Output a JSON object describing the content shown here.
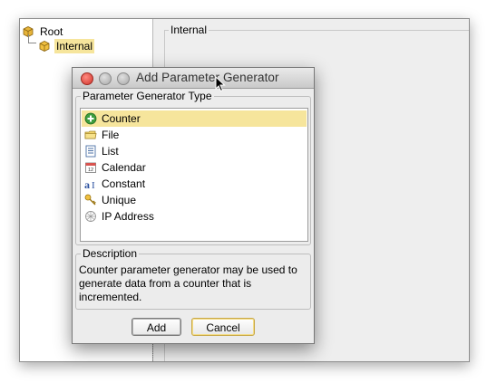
{
  "tree": {
    "root_label": "Root",
    "child_label": "Internal"
  },
  "main_panel": {
    "title": "Internal"
  },
  "dialog": {
    "title": "Add Parameter Generator",
    "type_group_title": "Parameter Generator Type",
    "generator_types": [
      {
        "label": "Counter",
        "icon": "plus-circle-icon",
        "selected": true
      },
      {
        "label": "File",
        "icon": "folder-icon",
        "selected": false
      },
      {
        "label": "List",
        "icon": "list-icon",
        "selected": false
      },
      {
        "label": "Calendar",
        "icon": "calendar-icon",
        "selected": false
      },
      {
        "label": "Constant",
        "icon": "constant-icon",
        "selected": false
      },
      {
        "label": "Unique",
        "icon": "key-icon",
        "selected": false
      },
      {
        "label": "IP Address",
        "icon": "network-icon",
        "selected": false
      }
    ],
    "description_title": "Description",
    "description_text": "Counter parameter generator may be used to generate data from a counter that is incremented.",
    "add_label": "Add",
    "cancel_label": "Cancel"
  },
  "colors": {
    "selection": "#f6e59c",
    "dialog_bg": "#ececec",
    "window_bg": "#eeeeee"
  }
}
